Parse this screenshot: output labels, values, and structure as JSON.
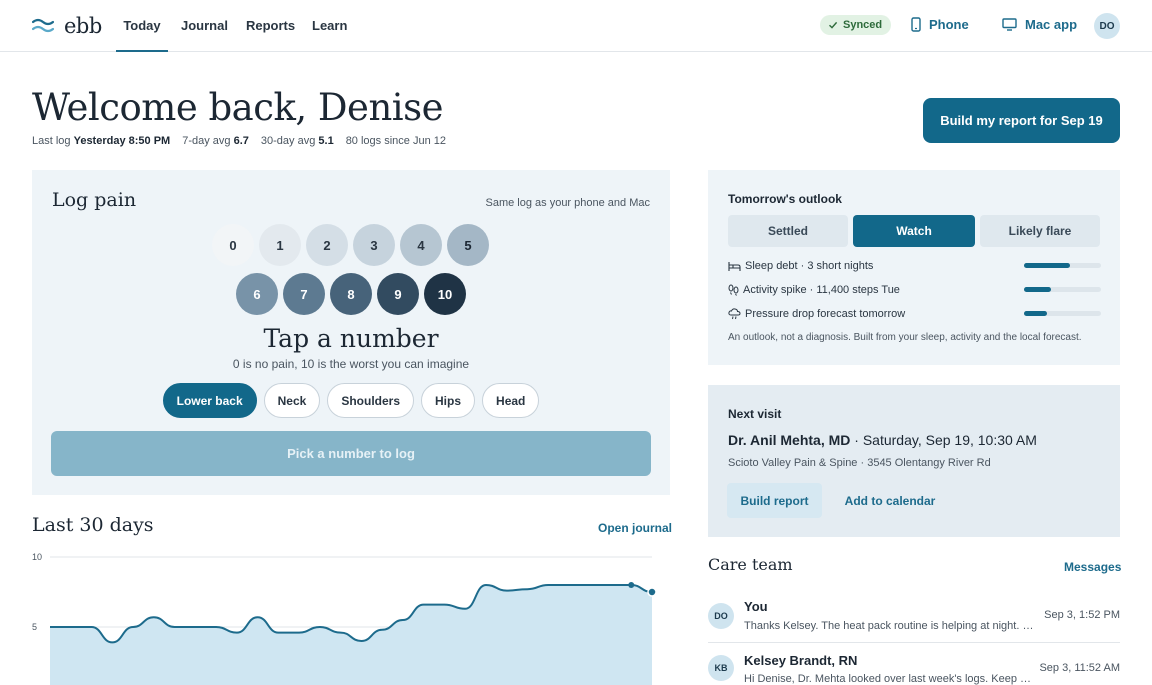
{
  "nav": {
    "logo_text": "ebb",
    "tabs": [
      {
        "label": "Today",
        "active": true
      },
      {
        "label": "Journal",
        "active": false
      },
      {
        "label": "Reports",
        "active": false
      },
      {
        "label": "Learn",
        "active": false
      }
    ],
    "synced_label": "Synced",
    "phone_label": "Phone",
    "mac_label": "Mac app",
    "avatar_initials": "DO"
  },
  "header": {
    "title": "Welcome back, Denise",
    "stats": {
      "last_log_label": "Last log",
      "last_log_value": "Yesterday 8:50 PM",
      "avg7_label": "7-day avg",
      "avg7_value": "6.7",
      "avg30_label": "30-day avg",
      "avg30_value": "5.1",
      "logs_text": "80 logs since Jun 12"
    },
    "build_button": "Build my report for Sep 19"
  },
  "log_pain": {
    "title": "Log pain",
    "hint": "Same log as your phone and Mac",
    "scale": [
      "0",
      "1",
      "2",
      "3",
      "4",
      "5",
      "6",
      "7",
      "8",
      "9",
      "10"
    ],
    "prompt": "Tap a number",
    "subprompt": "0 is no pain, 10 is the worst you can imagine",
    "locations": [
      {
        "label": "Lower back",
        "selected": true
      },
      {
        "label": "Neck",
        "selected": false
      },
      {
        "label": "Shoulders",
        "selected": false
      },
      {
        "label": "Hips",
        "selected": false
      },
      {
        "label": "Head",
        "selected": false
      }
    ],
    "submit_label": "Pick a number to log"
  },
  "last30": {
    "title": "Last 30 days",
    "open_journal": "Open journal"
  },
  "chart_data": {
    "type": "area",
    "title": "",
    "xlabel": "",
    "ylabel": "",
    "ylim": [
      0,
      10
    ],
    "yticks": [
      "10",
      "5"
    ],
    "x": [
      1,
      2,
      3,
      4,
      5,
      6,
      7,
      8,
      9,
      10,
      11,
      12,
      13,
      14,
      15,
      16,
      17,
      18,
      19,
      20,
      21,
      22,
      23,
      24,
      25,
      26,
      27,
      28,
      29,
      30
    ],
    "values": [
      5.0,
      5.0,
      5.0,
      3.9,
      5.0,
      5.7,
      5.0,
      5.0,
      5.0,
      4.6,
      5.7,
      4.6,
      4.6,
      5.0,
      4.6,
      4.0,
      4.8,
      5.5,
      6.6,
      6.6,
      6.3,
      8.0,
      7.6,
      7.7,
      8.0,
      8.0,
      8.0,
      8.0,
      8.0,
      7.5
    ],
    "series_color": "#1d6b8c",
    "fill_color": "#cfe6f2",
    "grid": true
  },
  "outlook": {
    "title": "Tomorrow's outlook",
    "options": [
      {
        "label": "Settled",
        "selected": false
      },
      {
        "label": "Watch",
        "selected": true
      },
      {
        "label": "Likely flare",
        "selected": false
      }
    ],
    "factors": [
      {
        "icon": "bed-icon",
        "text": "Sleep debt · 3 short nights",
        "level": 0.6
      },
      {
        "icon": "footprints-icon",
        "text": "Activity spike · 11,400 steps Tue",
        "level": 0.35
      },
      {
        "icon": "cloud-rain-icon",
        "text": "Pressure drop forecast tomorrow",
        "level": 0.3
      }
    ],
    "note": "An outlook, not a diagnosis. Built from your sleep, activity and the local forecast."
  },
  "visit": {
    "title": "Next visit",
    "doctor": "Dr. Anil Mehta, MD",
    "datetime": " · Saturday, Sep 19, 10:30 AM",
    "address": "Scioto Valley Pain & Spine · 3545 Olentangy River Rd",
    "build_report": "Build report",
    "add_calendar": "Add to calendar"
  },
  "care_team": {
    "title": "Care team",
    "messages_link": "Messages",
    "messages": [
      {
        "initials": "DO",
        "name": "You",
        "text": "Thanks Kelsey. The heat pack routine is helping at night. I'll keep it going.",
        "time": "Sep 3, 1:52 PM"
      },
      {
        "initials": "KB",
        "name": "Kelsey Brandt, RN",
        "text": "Hi Denise, Dr. Mehta looked over last week's logs. Keep going with the routine.",
        "time": "Sep 3, 11:52 AM"
      }
    ]
  },
  "colors": {
    "primary": "#12688a",
    "accent_link": "#1d6b8c",
    "card_bg": "#eef4f8"
  }
}
